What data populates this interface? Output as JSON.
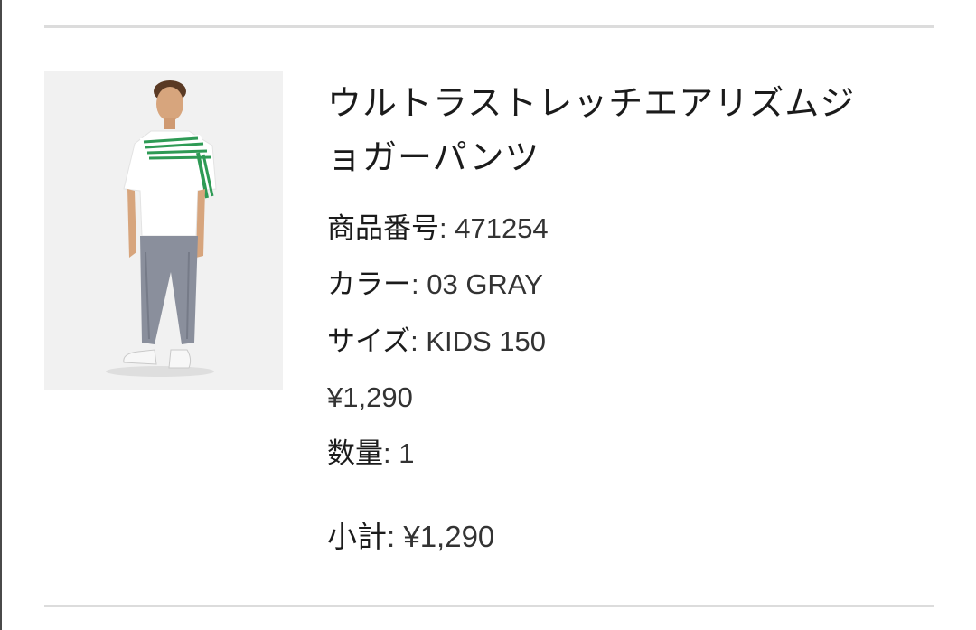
{
  "product": {
    "name_line1": "ウルトラストレッチエアリズムジ",
    "name_line2": "ョガーパンツ",
    "code_label": "商品番号",
    "code_value": ": 471254",
    "color_label": "カラー",
    "color_value": ": 03 GRAY",
    "size_label": "サイズ",
    "size_value": ": KIDS 150",
    "price": "¥1,290",
    "quantity_label": "数量",
    "quantity_value": ": 1",
    "subtotal_label": "小計",
    "subtotal_value": ": ¥1,290"
  },
  "colors": {
    "divider": "#dcdcdc",
    "text": "#1b1b1b",
    "image_background": "#f1f1f1",
    "pants": "#8a8f9c",
    "stripe": "#2e9a55"
  }
}
